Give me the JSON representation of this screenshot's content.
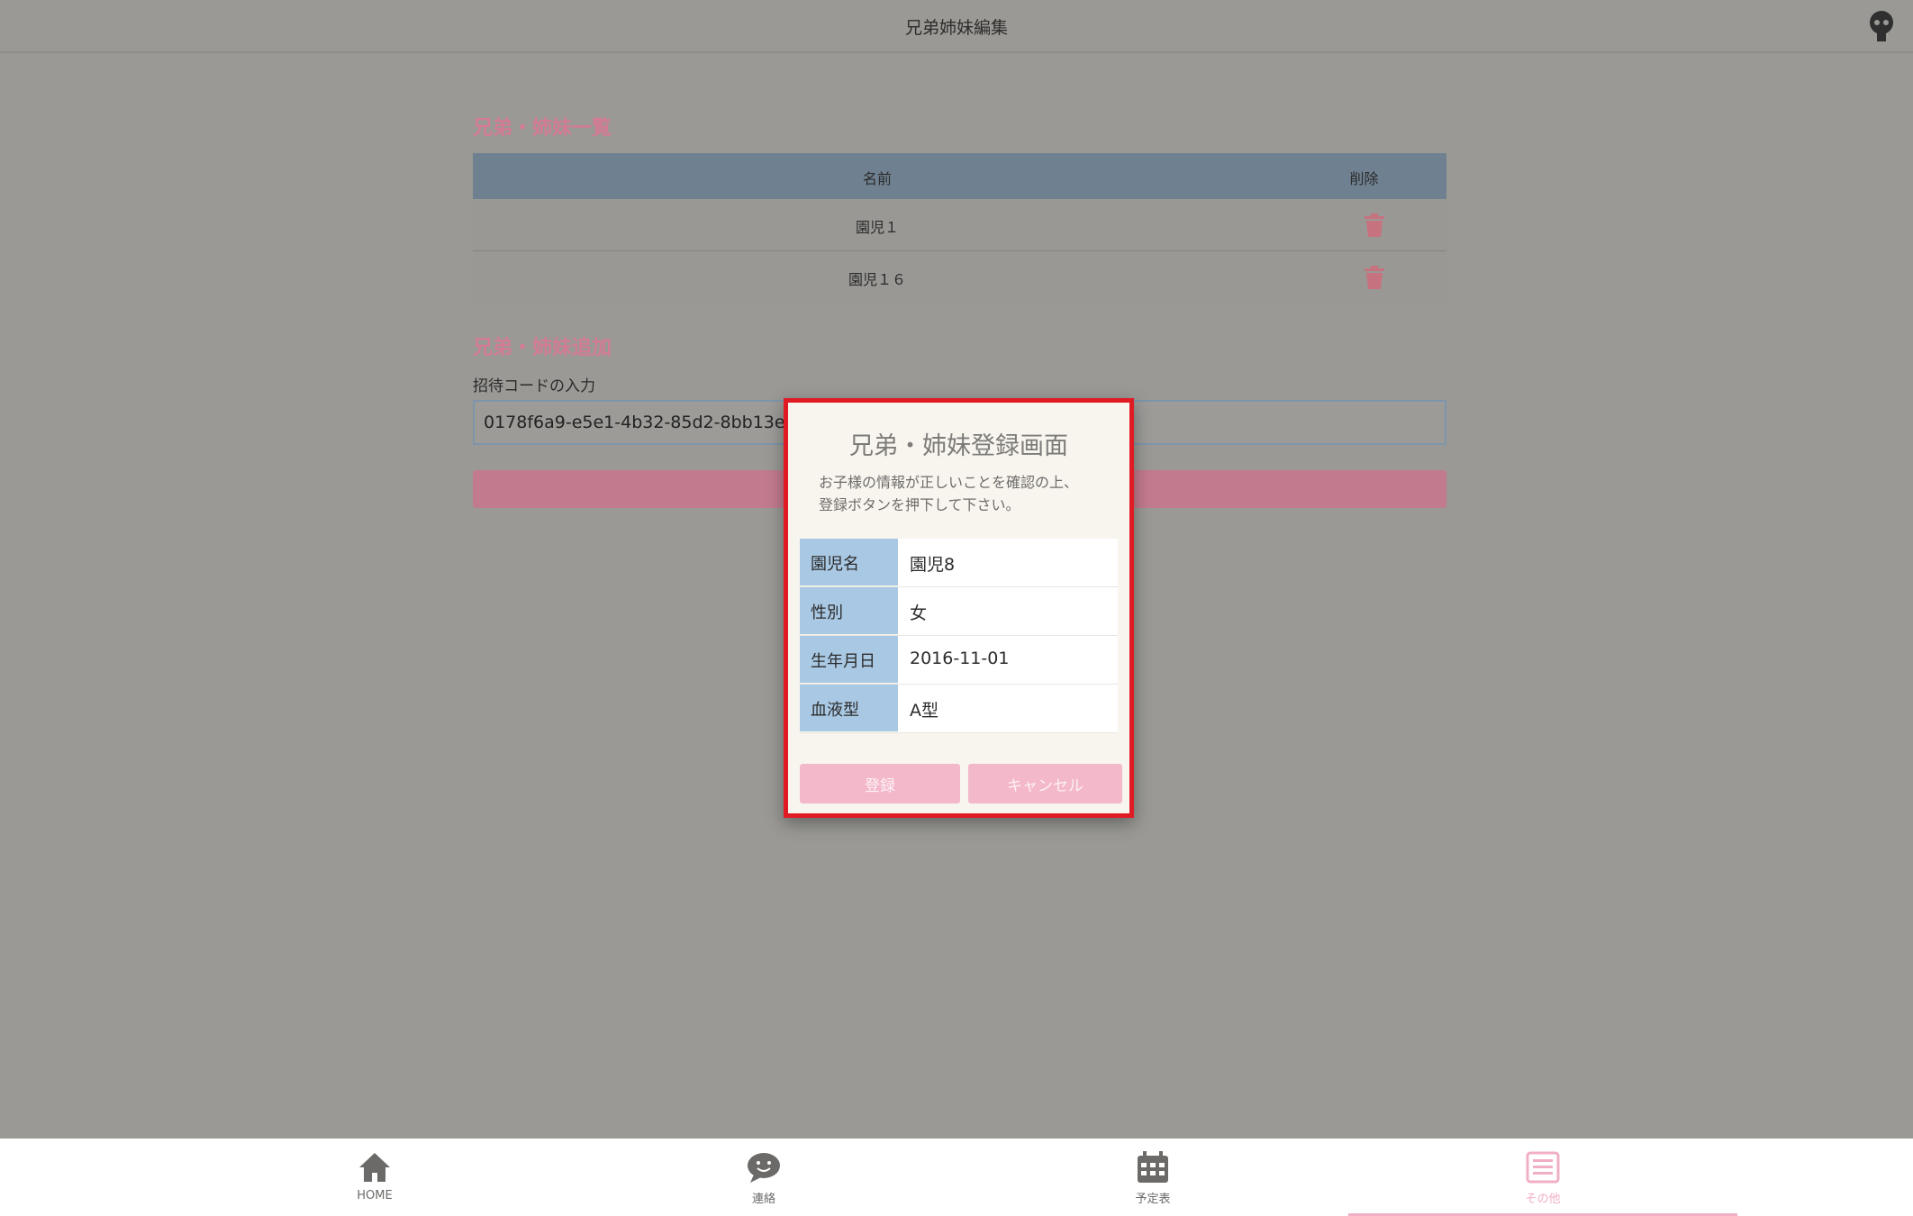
{
  "header": {
    "title": "兄弟姉妹編集",
    "avatar_icon": "user-avatar-icon"
  },
  "list_section": {
    "title": "兄弟・姉妹一覧",
    "columns": {
      "name": "名前",
      "delete": "削除"
    },
    "rows": [
      {
        "name": "園児１",
        "delete_icon": "trash-icon"
      },
      {
        "name": "園児１６",
        "delete_icon": "trash-icon"
      }
    ]
  },
  "add_section": {
    "title": "兄弟・姉妹追加",
    "code_label": "招待コードの入力",
    "code_value": "0178f6a9-e5e1-4b32-85d2-8bb13e"
  },
  "modal": {
    "title": "兄弟・姉妹登録画面",
    "description_line1": "お子様の情報が正しいことを確認の上、",
    "description_line2": "登録ボタンを押下して下さい。",
    "fields": [
      {
        "key": "園児名",
        "value": "園児8"
      },
      {
        "key": "性別",
        "value": "女"
      },
      {
        "key": "生年月日",
        "value": "2016-11-01"
      },
      {
        "key": "血液型",
        "value": "A型"
      }
    ],
    "register_label": "登録",
    "cancel_label": "キャンセル"
  },
  "nav": {
    "items": [
      {
        "label": "HOME",
        "icon": "home-icon"
      },
      {
        "label": "連絡",
        "icon": "chat-icon"
      },
      {
        "label": "予定表",
        "icon": "calendar-icon"
      },
      {
        "label": "その他",
        "icon": "menu-icon"
      }
    ],
    "active_index": 3
  },
  "colors": {
    "accent_pink": "#f1afc4",
    "section_title": "#d27b95",
    "table_header": "#6f8190",
    "modal_key_bg": "#a9c8e3",
    "modal_border": "#e01b24"
  }
}
